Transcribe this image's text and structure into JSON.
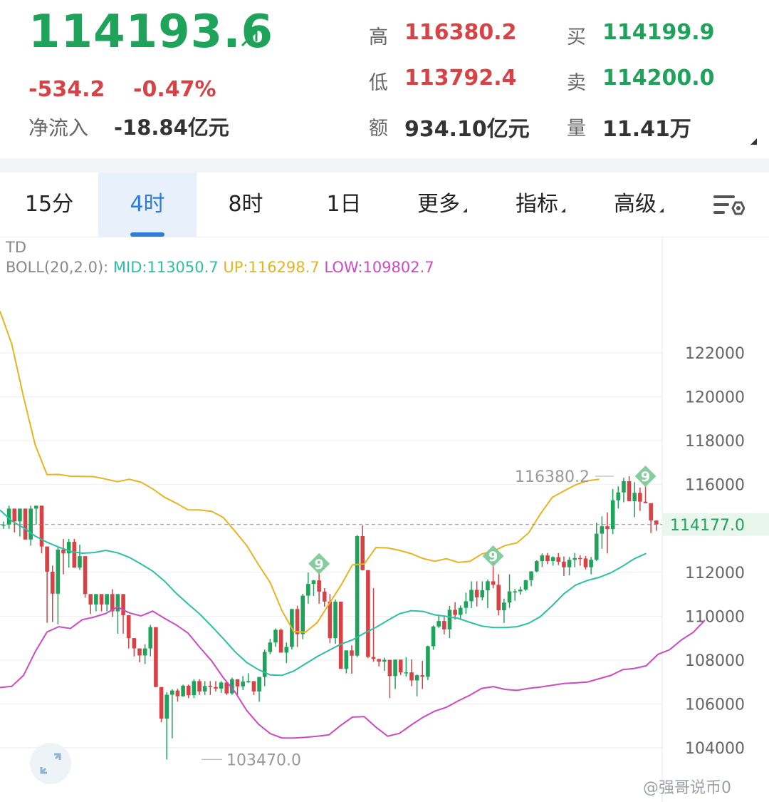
{
  "header": {
    "price": "114193.6",
    "arrow_icon": "up-right-arrow",
    "change": "-534.2",
    "change_pct": "-0.47%",
    "netflow_label": "净流入",
    "netflow_value": "-18.84亿元",
    "high_label": "高",
    "high_value": "116380.2",
    "low_label": "低",
    "low_value": "113792.4",
    "amount_label": "额",
    "amount_value": "934.10亿元",
    "buy_label": "买",
    "buy_value": "114199.9",
    "sell_label": "卖",
    "sell_value": "114200.0",
    "volume_label": "量",
    "volume_value": "11.41万",
    "colors": {
      "up": "#1fa35a",
      "down": "#d64245"
    }
  },
  "tabs": [
    {
      "label": "15分",
      "dropdown": false
    },
    {
      "label": "4时",
      "dropdown": false,
      "active": true
    },
    {
      "label": "8时",
      "dropdown": false
    },
    {
      "label": "1日",
      "dropdown": false
    },
    {
      "label": "更多",
      "dropdown": true
    },
    {
      "label": "指标",
      "dropdown": true
    },
    {
      "label": "高级",
      "dropdown": true
    }
  ],
  "settings_icon": "chart-settings-icon",
  "legend": {
    "line1": "TD",
    "boll_prefix": "BOLL(20,2.0):",
    "mid": "MID:113050.7",
    "up": "UP:116298.7",
    "low": "LOW:109802.7",
    "colors": {
      "mid": "#2bbfa4",
      "up": "#e6b422",
      "low": "#cc4bc2"
    }
  },
  "watermark": "@强哥说币0",
  "chart_data": {
    "type": "candlestick",
    "interval": "4时",
    "ylim": [
      103300,
      124500
    ],
    "y_ticks": [
      "122000",
      "120000",
      "118000",
      "116000",
      "114000",
      "112000",
      "110000",
      "108000",
      "106000",
      "104000"
    ],
    "current_price": 114177.0,
    "current_price_label": "114177.0",
    "max_marker": {
      "value": 116380.2,
      "label": "116380.2"
    },
    "min_marker": {
      "value": 103470.0,
      "label": "103470.0"
    },
    "td_markers": [
      {
        "label": "9",
        "index": 58
      },
      {
        "label": "9",
        "index": 90
      },
      {
        "label": "9",
        "index": 118
      }
    ],
    "candles": [
      [
        114174,
        114315,
        113981,
        114174
      ],
      [
        114174,
        115036,
        113981,
        114903
      ],
      [
        114903,
        114903,
        113822,
        114321
      ],
      [
        114321,
        114903,
        113632,
        114903
      ],
      [
        114903,
        114903,
        113493,
        113493
      ],
      [
        113493,
        115036,
        113212,
        114903
      ],
      [
        114903,
        115036,
        114174,
        115036
      ],
      [
        115036,
        115036,
        112860,
        113176
      ],
      [
        113176,
        113176,
        109700,
        112028
      ],
      [
        112028,
        112310,
        109735,
        111025
      ],
      [
        111025,
        113176,
        109628,
        113035
      ],
      [
        113035,
        113519,
        111904,
        112860
      ],
      [
        112860,
        113519,
        112212,
        113387
      ],
      [
        113387,
        113519,
        112210,
        112210
      ],
      [
        112210,
        113256,
        112102,
        112735
      ],
      [
        112735,
        112735,
        110840,
        111007
      ],
      [
        111007,
        111007,
        110102,
        110532
      ],
      [
        110532,
        111007,
        110220,
        111007
      ],
      [
        111007,
        111007,
        110220,
        110532
      ],
      [
        110532,
        111007,
        110220,
        111007
      ],
      [
        111007,
        111232,
        109965,
        110220
      ],
      [
        110220,
        111007,
        109200,
        111007
      ],
      [
        111007,
        111007,
        109200,
        110045
      ],
      [
        110045,
        110045,
        108530,
        109000
      ],
      [
        109000,
        109000,
        108170,
        108530
      ],
      [
        108530,
        108530,
        107895,
        108210
      ],
      [
        108210,
        108720,
        107820,
        108530
      ],
      [
        108530,
        109600,
        108170,
        109500
      ],
      [
        109500,
        109500,
        106770,
        106770
      ],
      [
        106770,
        106770,
        105170,
        105330
      ],
      [
        105330,
        106530,
        103470,
        106420
      ],
      [
        106420,
        106670,
        104432,
        106610
      ],
      [
        106610,
        106690,
        106100,
        106350
      ],
      [
        106350,
        106880,
        106330,
        106830
      ],
      [
        106830,
        106880,
        106265,
        106400
      ],
      [
        106400,
        107130,
        106265,
        107040
      ],
      [
        107040,
        107130,
        106410,
        106570
      ],
      [
        106570,
        107040,
        106410,
        106815
      ],
      [
        106815,
        107040,
        106410,
        106770
      ],
      [
        106770,
        107040,
        106570,
        106700
      ],
      [
        106700,
        107040,
        106500,
        106975
      ],
      [
        106975,
        107040,
        106410,
        106480
      ],
      [
        106480,
        107200,
        106410,
        107125
      ],
      [
        107125,
        107125,
        106410,
        106800
      ],
      [
        106800,
        107270,
        106630,
        107020
      ],
      [
        107020,
        107400,
        106960,
        107040
      ],
      [
        107040,
        107040,
        106410,
        106570
      ],
      [
        106570,
        107230,
        106100,
        107230
      ],
      [
        107230,
        108480,
        106810,
        108370
      ],
      [
        108370,
        108970,
        108270,
        108800
      ],
      [
        108800,
        109440,
        108600,
        109380
      ],
      [
        109380,
        109440,
        108340,
        108340
      ],
      [
        108340,
        108800,
        107860,
        108600
      ],
      [
        108600,
        110325,
        108480,
        110325
      ],
      [
        110325,
        110480,
        108600,
        109180
      ],
      [
        109180,
        111020,
        108950,
        110935
      ],
      [
        110935,
        111990,
        110570,
        111470
      ],
      [
        111470,
        111650,
        110920,
        111630
      ],
      [
        111630,
        112130,
        110570,
        111120
      ],
      [
        111120,
        111280,
        110430,
        110665
      ],
      [
        110665,
        111010,
        108770,
        109000
      ],
      [
        109000,
        110760,
        108740,
        110660
      ],
      [
        110660,
        110650,
        107600,
        107600
      ],
      [
        107600,
        108440,
        107395,
        108440
      ],
      [
        108440,
        108670,
        107380,
        108200
      ],
      [
        108200,
        113700,
        108130,
        113650
      ],
      [
        113650,
        114140,
        112080,
        112100
      ],
      [
        112100,
        112100,
        108090,
        108140
      ],
      [
        108140,
        111280,
        107920,
        108050
      ],
      [
        108050,
        108050,
        107710,
        107930
      ],
      [
        107930,
        108110,
        107510,
        108010
      ],
      [
        108010,
        108010,
        106260,
        107270
      ],
      [
        107270,
        108020,
        106680,
        108020
      ],
      [
        108020,
        108020,
        107320,
        107440
      ],
      [
        107440,
        108130,
        107240,
        107440
      ],
      [
        107440,
        108030,
        106810,
        107070
      ],
      [
        107070,
        107340,
        106350,
        107310
      ],
      [
        107310,
        107960,
        106680,
        107240
      ],
      [
        107240,
        108660,
        107090,
        108630
      ],
      [
        108630,
        109580,
        108470,
        109530
      ],
      [
        109530,
        110010,
        109460,
        109780
      ],
      [
        109780,
        109990,
        109170,
        109400
      ],
      [
        109400,
        110470,
        109000,
        110290
      ],
      [
        110290,
        110640,
        109850,
        110060
      ],
      [
        110060,
        110490,
        109830,
        110380
      ],
      [
        110380,
        111070,
        110110,
        110680
      ],
      [
        110680,
        111590,
        110370,
        111200
      ],
      [
        111200,
        111590,
        110440,
        110860
      ],
      [
        110860,
        111590,
        110720,
        111180
      ],
      [
        111180,
        111670,
        110370,
        111590
      ],
      [
        111590,
        112480,
        111280,
        111430
      ],
      [
        111430,
        111910,
        110040,
        110270
      ],
      [
        110270,
        110800,
        109690,
        110620
      ],
      [
        110620,
        111910,
        110380,
        111130
      ],
      [
        111130,
        111240,
        110700,
        111130
      ],
      [
        111130,
        111350,
        110980,
        111210
      ],
      [
        111210,
        111660,
        111150,
        111640
      ],
      [
        111640,
        112050,
        111370,
        112040
      ],
      [
        112040,
        112550,
        112000,
        112510
      ],
      [
        112510,
        112860,
        112240,
        112770
      ],
      [
        112770,
        112880,
        112370,
        112510
      ],
      [
        112510,
        112730,
        112300,
        112690
      ],
      [
        112690,
        112880,
        112330,
        112480
      ],
      [
        112480,
        112720,
        111830,
        112230
      ],
      [
        112230,
        112700,
        111860,
        112570
      ],
      [
        112570,
        112880,
        112230,
        112650
      ],
      [
        112650,
        112780,
        112300,
        112630
      ],
      [
        112630,
        112740,
        112130,
        112230
      ],
      [
        112230,
        112700,
        111910,
        112570
      ],
      [
        112570,
        114260,
        112510,
        113760
      ],
      [
        113760,
        114550,
        113070,
        114100
      ],
      [
        114100,
        114730,
        112860,
        113970
      ],
      [
        113970,
        115800,
        113740,
        115280
      ],
      [
        115280,
        115920,
        114910,
        115640
      ],
      [
        115640,
        116310,
        115190,
        116150
      ],
      [
        116150,
        116380,
        115360,
        115240
      ],
      [
        115240,
        116110,
        114510,
        115620
      ],
      [
        115620,
        115860,
        114800,
        115220
      ],
      [
        115220,
        116120,
        115170,
        115150
      ],
      [
        115150,
        115150,
        113790,
        114360
      ],
      [
        114360,
        114360,
        113890,
        114180
      ]
    ],
    "mid": [
      114835,
      114340,
      114030,
      113650,
      113370,
      113150,
      112950,
      112870,
      112900,
      113000,
      112890,
      112680,
      112380,
      112050,
      111600,
      111040,
      110560,
      110100,
      109550,
      108980,
      108380,
      107890,
      107560,
      107320,
      107300,
      107500,
      107830,
      108160,
      108440,
      108720,
      108920,
      109220,
      109490,
      109810,
      110110,
      110250,
      110220,
      110060,
      109990,
      109900,
      109720,
      109550,
      109480,
      109480,
      109520,
      109680,
      109980,
      110480,
      111020,
      111420,
      111630,
      111770,
      111980,
      112280,
      112620,
      112860
    ],
    "up": [
      123900,
      122400,
      120000,
      117800,
      116450,
      116460,
      116380,
      116370,
      116360,
      116250,
      116130,
      116240,
      116110,
      115800,
      115420,
      115150,
      114850,
      114840,
      114780,
      114500,
      113870,
      113220,
      112350,
      111530,
      110250,
      109300,
      109270,
      109710,
      110550,
      111390,
      112340,
      112380,
      113130,
      113110,
      113000,
      112850,
      112630,
      112500,
      112620,
      112450,
      112500,
      112830,
      112970,
      113220,
      113340,
      113800,
      114660,
      115410,
      115710,
      115990,
      116170,
      116240
    ],
    "low": [
      106750,
      106800,
      107300,
      108380,
      109280,
      109520,
      109440,
      109840,
      109960,
      110120,
      110420,
      110150,
      110010,
      110230,
      109900,
      109600,
      109230,
      108580,
      107970,
      107200,
      106550,
      105700,
      105080,
      104650,
      104450,
      104450,
      104480,
      104530,
      104590,
      105020,
      105400,
      105420,
      104940,
      104530,
      104660,
      105040,
      105390,
      105670,
      105850,
      106140,
      106400,
      106710,
      106790,
      106660,
      106620,
      106710,
      106770,
      106850,
      106930,
      106960,
      107000,
      107150,
      107300,
      107560,
      107620,
      107740,
      108260,
      108470,
      108920,
      109260,
      109820
    ],
    "band_x_step": 11
  }
}
